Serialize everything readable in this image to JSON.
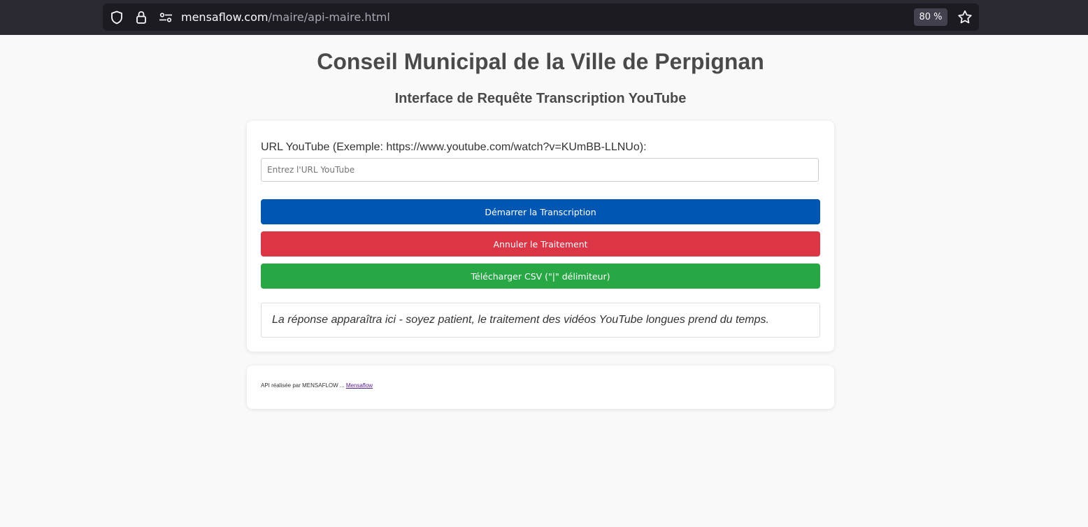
{
  "browser": {
    "url_host": "mensaflow.com",
    "url_path": "/maire/api-maire.html",
    "zoom": "80 %",
    "icons": {
      "shield": "shield-icon",
      "lock": "lock-icon",
      "permissions": "permissions-icon",
      "bookmark": "star-icon"
    }
  },
  "header": {
    "title": "Conseil Municipal de la Ville de Perpignan",
    "subtitle": "Interface de Requête Transcription YouTube"
  },
  "form": {
    "label": "URL YouTube (Exemple: https://www.youtube.com/watch?v=KUmBB-LLNUo):",
    "input_value": "",
    "input_placeholder": "Entrez l'URL YouTube",
    "start_button": "Démarrer la Transcription",
    "cancel_button": "Annuler le Traitement",
    "csv_button": "Télécharger CSV (\"|\" délimiteur)",
    "response_text": "La réponse apparaîtra ici - soyez patient, le traitement des vidéos YouTube longues prend du temps."
  },
  "footer": {
    "text": "API réalisée par MENSAFLOW ... ",
    "link_label": "Mensaflow"
  },
  "colors": {
    "start": "#0057b3",
    "cancel": "#dc3545",
    "csv": "#28a745",
    "toolbar": "#2b2a33"
  }
}
